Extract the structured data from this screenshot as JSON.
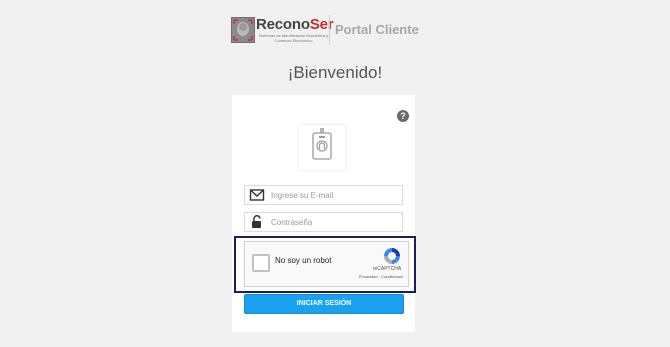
{
  "header": {
    "logo_name_part1": "Recono",
    "logo_name_part2": "Ser",
    "logo_tagline": "Sistemas de Identificación Biométrica y Comercio Electrónico",
    "portal_title": "Portal Cliente"
  },
  "welcome_text": "¡Bienvenido!",
  "help_icon": {
    "symbol": "?",
    "icon": "question-circle-icon"
  },
  "form": {
    "email_placeholder": "Ingrese su E-mail",
    "email_value": "",
    "email_icon": "envelope-icon",
    "password_placeholder": "Contraseña",
    "password_value": "",
    "password_icon": "unlock-icon",
    "captcha": {
      "label": "No soy un robot",
      "brand": "reCAPTCHA",
      "links": "Privacidad - Condiciones",
      "checked": false,
      "icon": "recaptcha-icon"
    },
    "submit_label": "INICIAR SESIÓN"
  },
  "colors": {
    "accent": "#1aa1f0",
    "brand_red": "#c92a2a",
    "captcha_outline": "#1a1f5a",
    "background": "#f1f1f1"
  }
}
